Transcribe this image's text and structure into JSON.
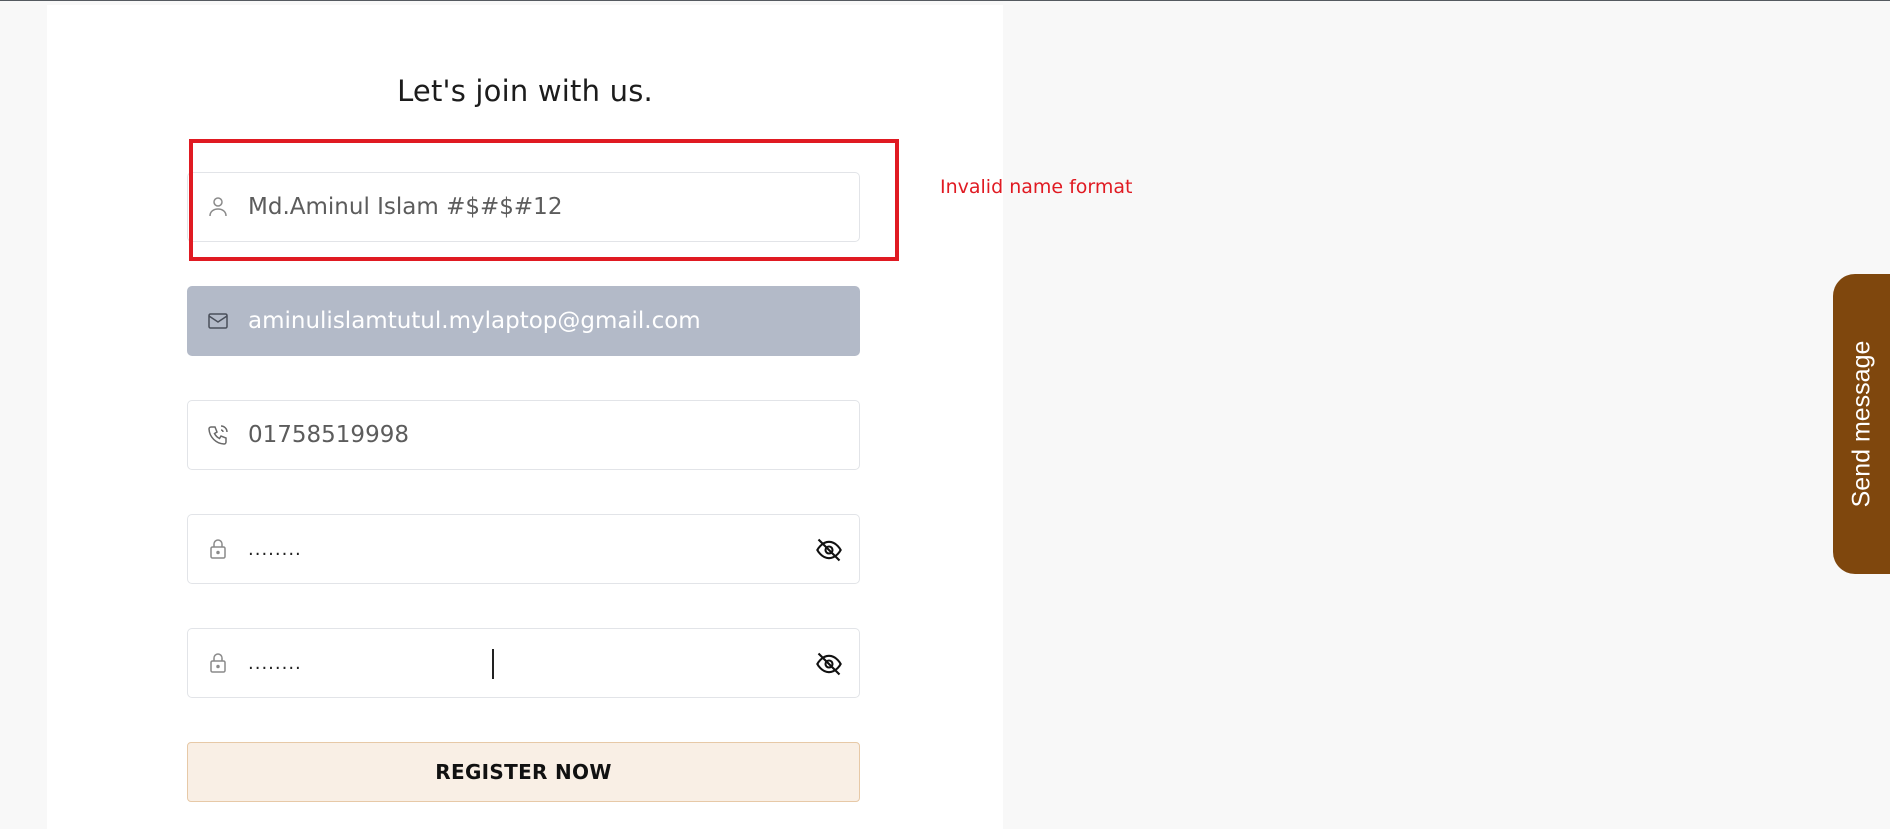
{
  "page": {
    "title": "Let's join with us."
  },
  "form": {
    "name": {
      "value": "Md.Aminul Islam #$#$#12",
      "icon": "user-icon"
    },
    "email": {
      "value": "aminulislamtutul.mylaptop@gmail.com",
      "icon": "mail-icon",
      "state": "disabled"
    },
    "phone": {
      "value": "01758519998",
      "icon": "phone-icon"
    },
    "password": {
      "value": "........",
      "icon": "lock-icon",
      "toggle_icon": "eye-off-icon"
    },
    "confirm_password": {
      "value": "........",
      "icon": "lock-icon",
      "toggle_icon": "eye-off-icon"
    },
    "error_message": "Invalid name format",
    "register_label": "REGISTER NOW"
  },
  "send_message": {
    "label": "Send message"
  },
  "colors": {
    "error": "#e01a22",
    "disabled_field": "#b3bac8",
    "button_bg": "#f9efe5",
    "tab_bg": "#7f470d"
  }
}
